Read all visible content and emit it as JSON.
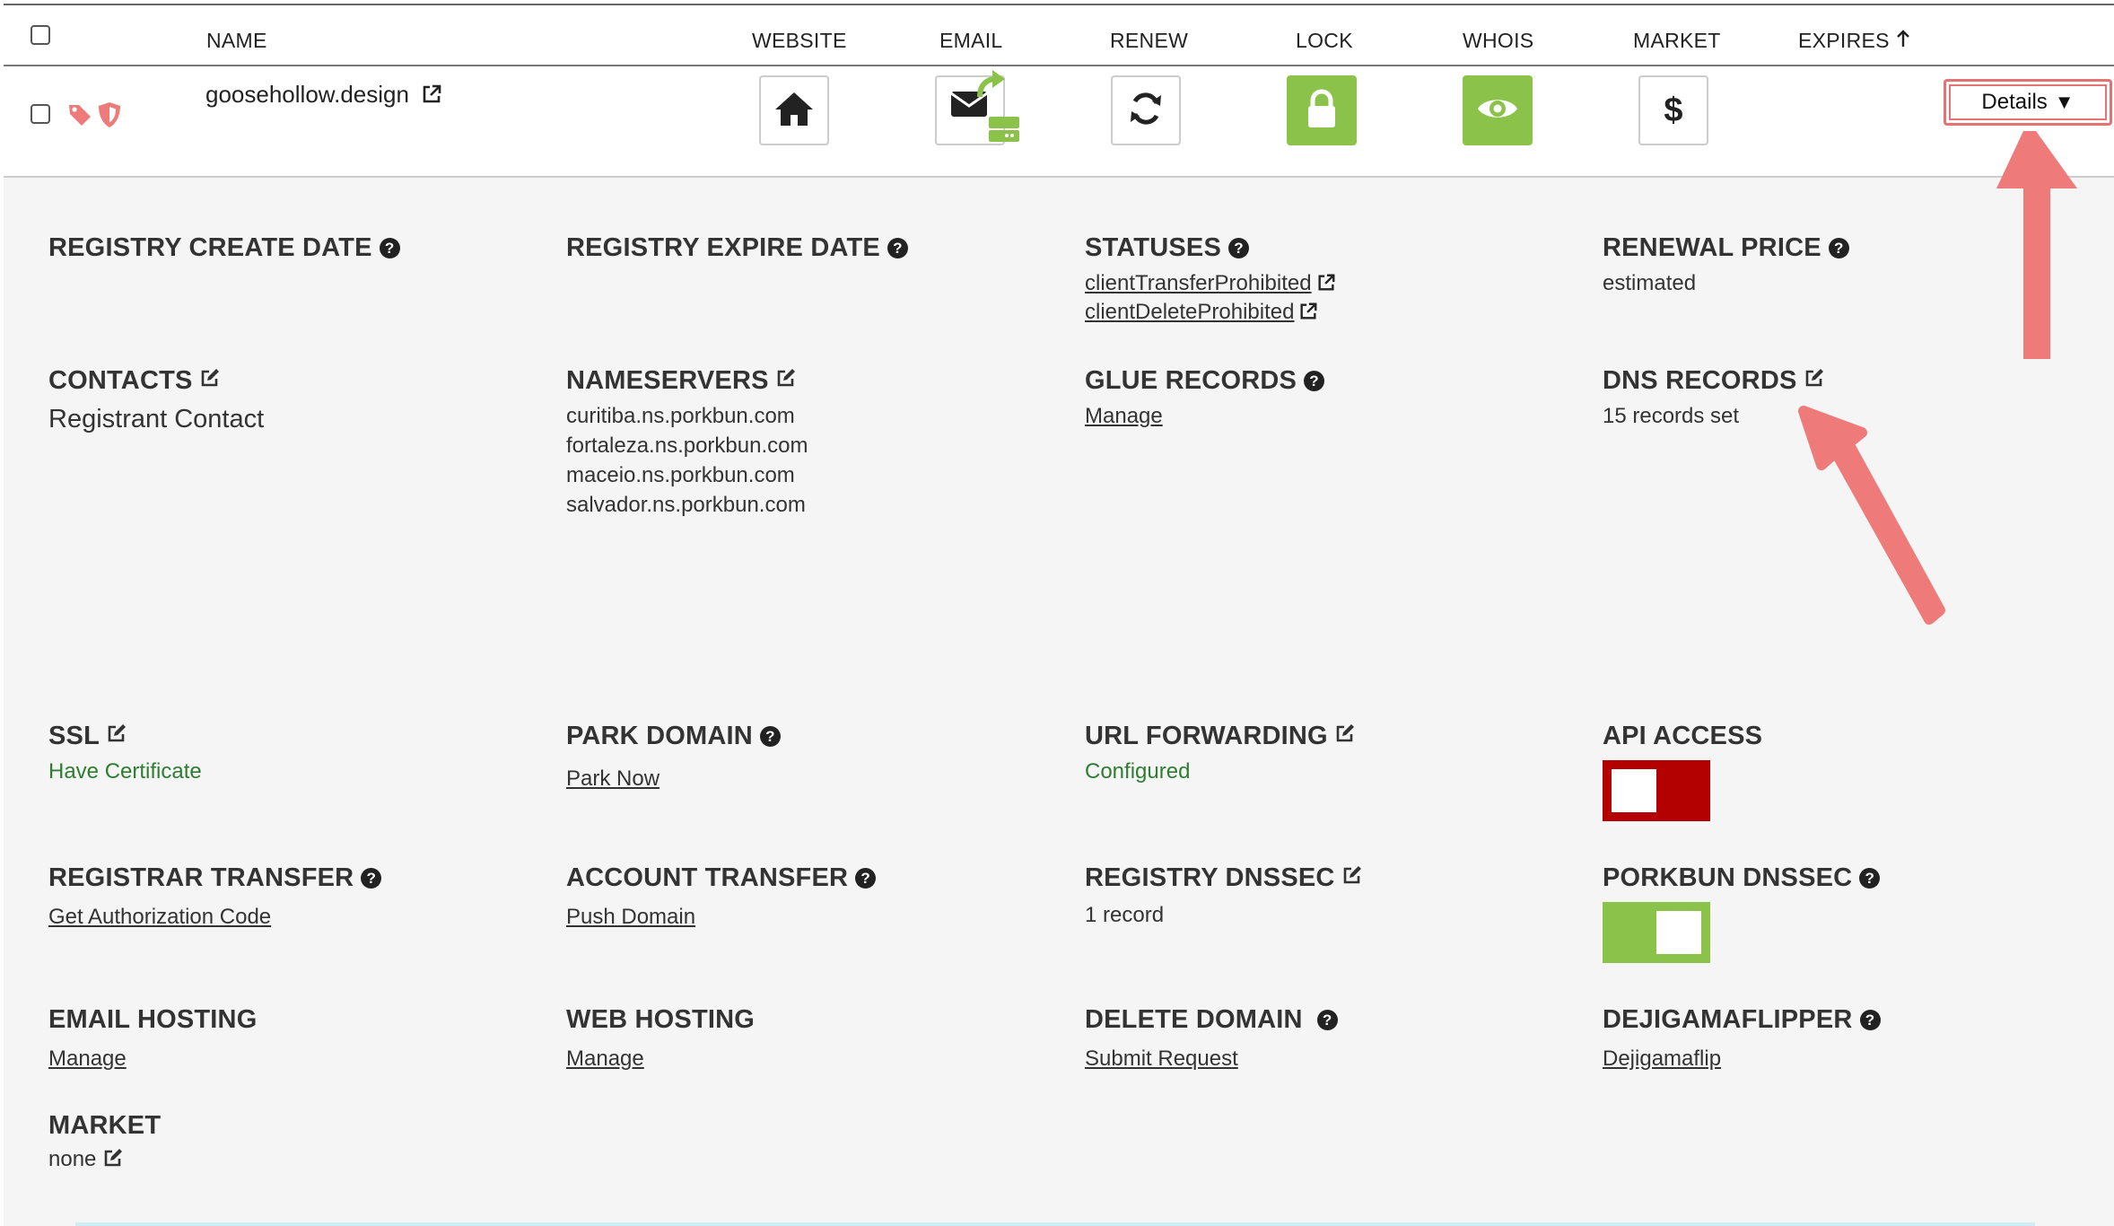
{
  "header": {
    "columns": {
      "name": "NAME",
      "website": "WEBSITE",
      "email": "EMAIL",
      "renew": "RENEW",
      "lock": "LOCK",
      "whois": "WHOIS",
      "market": "MARKET",
      "expires": "EXPIRES"
    }
  },
  "domain": {
    "name": "goosehollow.design",
    "details_label": "Details",
    "market_symbol": "$"
  },
  "details": {
    "registry_create_date": {
      "label": "REGISTRY CREATE DATE"
    },
    "registry_expire_date": {
      "label": "REGISTRY EXPIRE DATE"
    },
    "statuses": {
      "label": "STATUSES",
      "items": [
        "clientTransferProhibited",
        "clientDeleteProhibited"
      ]
    },
    "renewal_price": {
      "label": "RENEWAL PRICE",
      "value": "estimated"
    },
    "contacts": {
      "label": "CONTACTS",
      "value": "Registrant Contact"
    },
    "nameservers": {
      "label": "NAMESERVERS",
      "items": [
        "curitiba.ns.porkbun.com",
        "fortaleza.ns.porkbun.com",
        "maceio.ns.porkbun.com",
        "salvador.ns.porkbun.com"
      ]
    },
    "glue_records": {
      "label": "GLUE RECORDS",
      "value": "Manage"
    },
    "dns_records": {
      "label": "DNS RECORDS",
      "value": "15 records set"
    },
    "ssl": {
      "label": "SSL",
      "value": "Have Certificate"
    },
    "park_domain": {
      "label": "PARK DOMAIN",
      "value": "Park Now"
    },
    "url_forwarding": {
      "label": "URL FORWARDING",
      "value": "Configured"
    },
    "api_access": {
      "label": "API ACCESS",
      "enabled": false
    },
    "registrar_transfer": {
      "label": "REGISTRAR TRANSFER",
      "value": "Get Authorization Code"
    },
    "account_transfer": {
      "label": "ACCOUNT TRANSFER",
      "value": "Push Domain"
    },
    "registry_dnssec": {
      "label": "REGISTRY DNSSEC",
      "value": "1 record"
    },
    "porkbun_dnssec": {
      "label": "PORKBUN DNSSEC",
      "enabled": true
    },
    "email_hosting": {
      "label": "EMAIL HOSTING",
      "value": "Manage"
    },
    "web_hosting": {
      "label": "WEB HOSTING",
      "value": "Manage"
    },
    "delete_domain": {
      "label": "DELETE DOMAIN",
      "value": "Submit Request"
    },
    "dejigamaflipper": {
      "label": "DEJIGAMAFLIPPER",
      "value": "Dejigamaflip"
    },
    "market": {
      "label": "MARKET",
      "value": "none"
    }
  },
  "colors": {
    "accent_green": "#8bc34a",
    "toggle_off_red": "#b30000",
    "annotation_arrow": "#ef7a7a",
    "success_text": "#2e7d32"
  }
}
